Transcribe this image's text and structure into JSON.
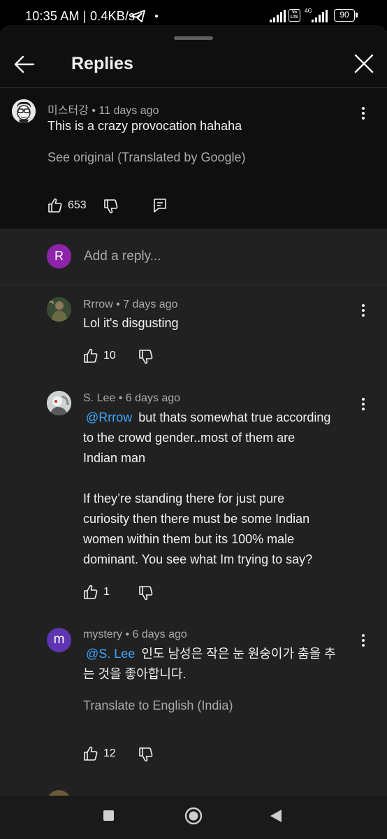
{
  "status": {
    "time": "10:35 AM",
    "speed": "0.4KB/s",
    "network": "4G",
    "volte": "Vo LTE",
    "battery": "90"
  },
  "header": {
    "title": "Replies"
  },
  "parent_comment": {
    "author": "미스터강",
    "time": "11 days ago",
    "text": "This is a crazy provocation hahaha",
    "translation_link": "See original (Translated by Google)",
    "likes": "653"
  },
  "reply_box": {
    "avatar_letter": "R",
    "placeholder": "Add a reply..."
  },
  "replies": [
    {
      "author": "Rrrow",
      "time": "7 days ago",
      "text": "Lol it's disgusting",
      "likes": "10"
    },
    {
      "author": "S. Lee",
      "time": "6 days ago",
      "mention": "@Rrrow",
      "text_line1": "but thats somewhat true according",
      "text_line2": "to the crowd gender..most of them are",
      "text_line3": "Indian man",
      "text_line4": "If they’re standing there for just pure",
      "text_line5": "curiosity then there must be some Indian",
      "text_line6": "women within them but its 100% male",
      "text_line7": "dominant. You see what Im trying to say?",
      "likes": "1"
    },
    {
      "author": "mystery",
      "avatar_letter": "m",
      "time": "6 days ago",
      "mention": "@S. Lee",
      "text_line1": "인도 남성은 작은 눈 원숭이가 춤을 추",
      "text_line2": "는 것을 좋아합니다.",
      "translation_link": "Translate to English (India)",
      "likes": "12"
    }
  ],
  "colors": {
    "background": "#0f0f0f",
    "reply_background": "#212121",
    "mention": "#3ea6ff",
    "muted": "#aaaaaa",
    "avatar_purple": "#8e24aa",
    "avatar_mystery": "#5e35b1"
  }
}
